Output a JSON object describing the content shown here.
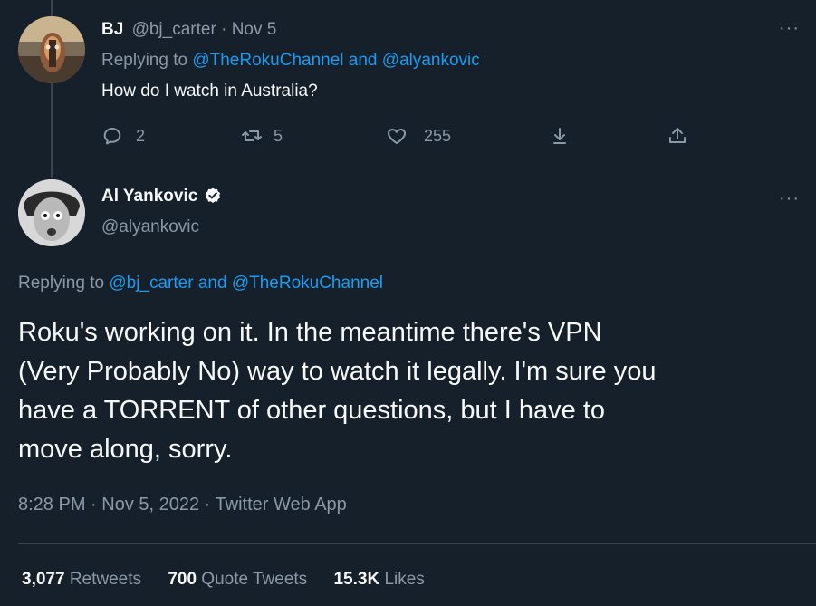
{
  "reply_tweet": {
    "display_name": "BJ",
    "handle": "@bj_carter",
    "separator": "·",
    "date": "Nov 5",
    "replying_prefix": "Replying to",
    "replying_to_1": "@TheRokuChannel",
    "replying_and": "and",
    "replying_to_2": "@alyankovic",
    "text": "How do I watch in Australia?",
    "actions": {
      "reply_count": "2",
      "retweet_count": "5",
      "like_count": "255"
    },
    "more_icon": "more-icon"
  },
  "main_tweet": {
    "display_name": "Al Yankovic",
    "handle": "@alyankovic",
    "verified_icon": "verified-badge-icon",
    "replying_prefix": "Replying to",
    "replying_to_1": "@bj_carter",
    "replying_and": "and",
    "replying_to_2": "@TheRokuChannel",
    "text_lines": [
      "Roku's working on it. In the meantime there's VPN",
      "(Very Probably No) way to watch it legally. I'm sure you",
      "have a TORRENT of other questions, but I have to",
      "move along, sorry."
    ],
    "meta": "8:28 PM · Nov 5, 2022 · Twitter Web App",
    "stats": {
      "retweets_count": "3,077",
      "retweets_label": "Retweets",
      "quotes_count": "700",
      "quotes_label": "Quote Tweets",
      "likes_count": "15.3K",
      "likes_label": "Likes"
    }
  },
  "colors": {
    "background": "#15202b",
    "text": "#f7f9f9",
    "muted": "#8b98a5",
    "link": "#1d9bf0",
    "divider": "#38444d"
  }
}
